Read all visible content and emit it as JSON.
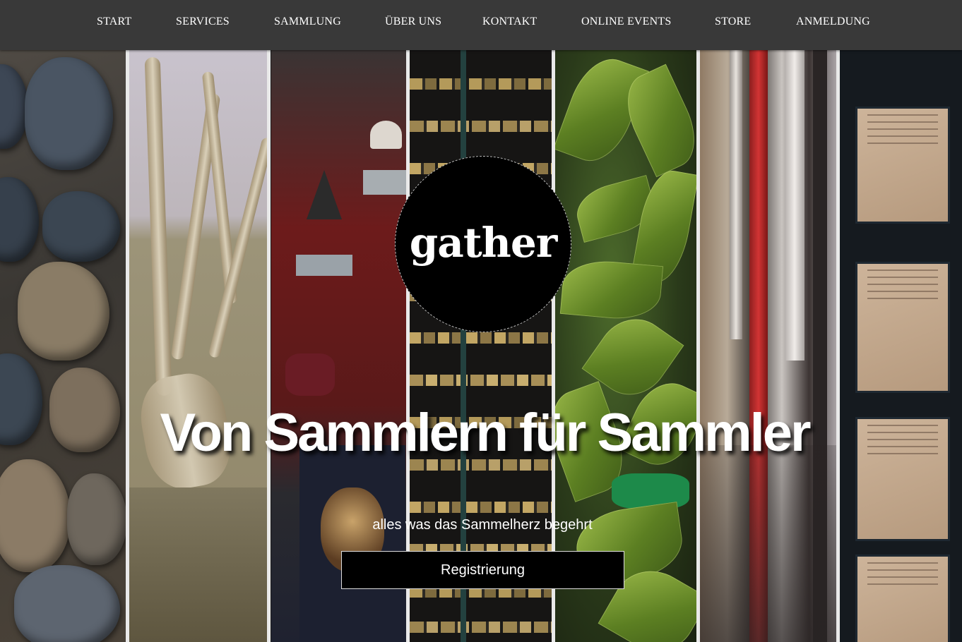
{
  "nav": {
    "items": [
      {
        "label": "START"
      },
      {
        "label": "SERVICES"
      },
      {
        "label": "SAMMLUNG"
      },
      {
        "label": "ÜBER UNS"
      },
      {
        "label": "KONTAKT"
      },
      {
        "label": "ONLINE EVENTS"
      },
      {
        "label": "STORE"
      },
      {
        "label": "ANMELDUNG"
      }
    ]
  },
  "hero": {
    "logo_text": "gather",
    "headline": "Von Sammlern für Sammler",
    "subline": "alles was das Sammelherz begehrt",
    "cta_label": "Registrierung"
  },
  "colors": {
    "nav_background": "#393939",
    "button_background": "#000000",
    "text": "#ffffff"
  }
}
